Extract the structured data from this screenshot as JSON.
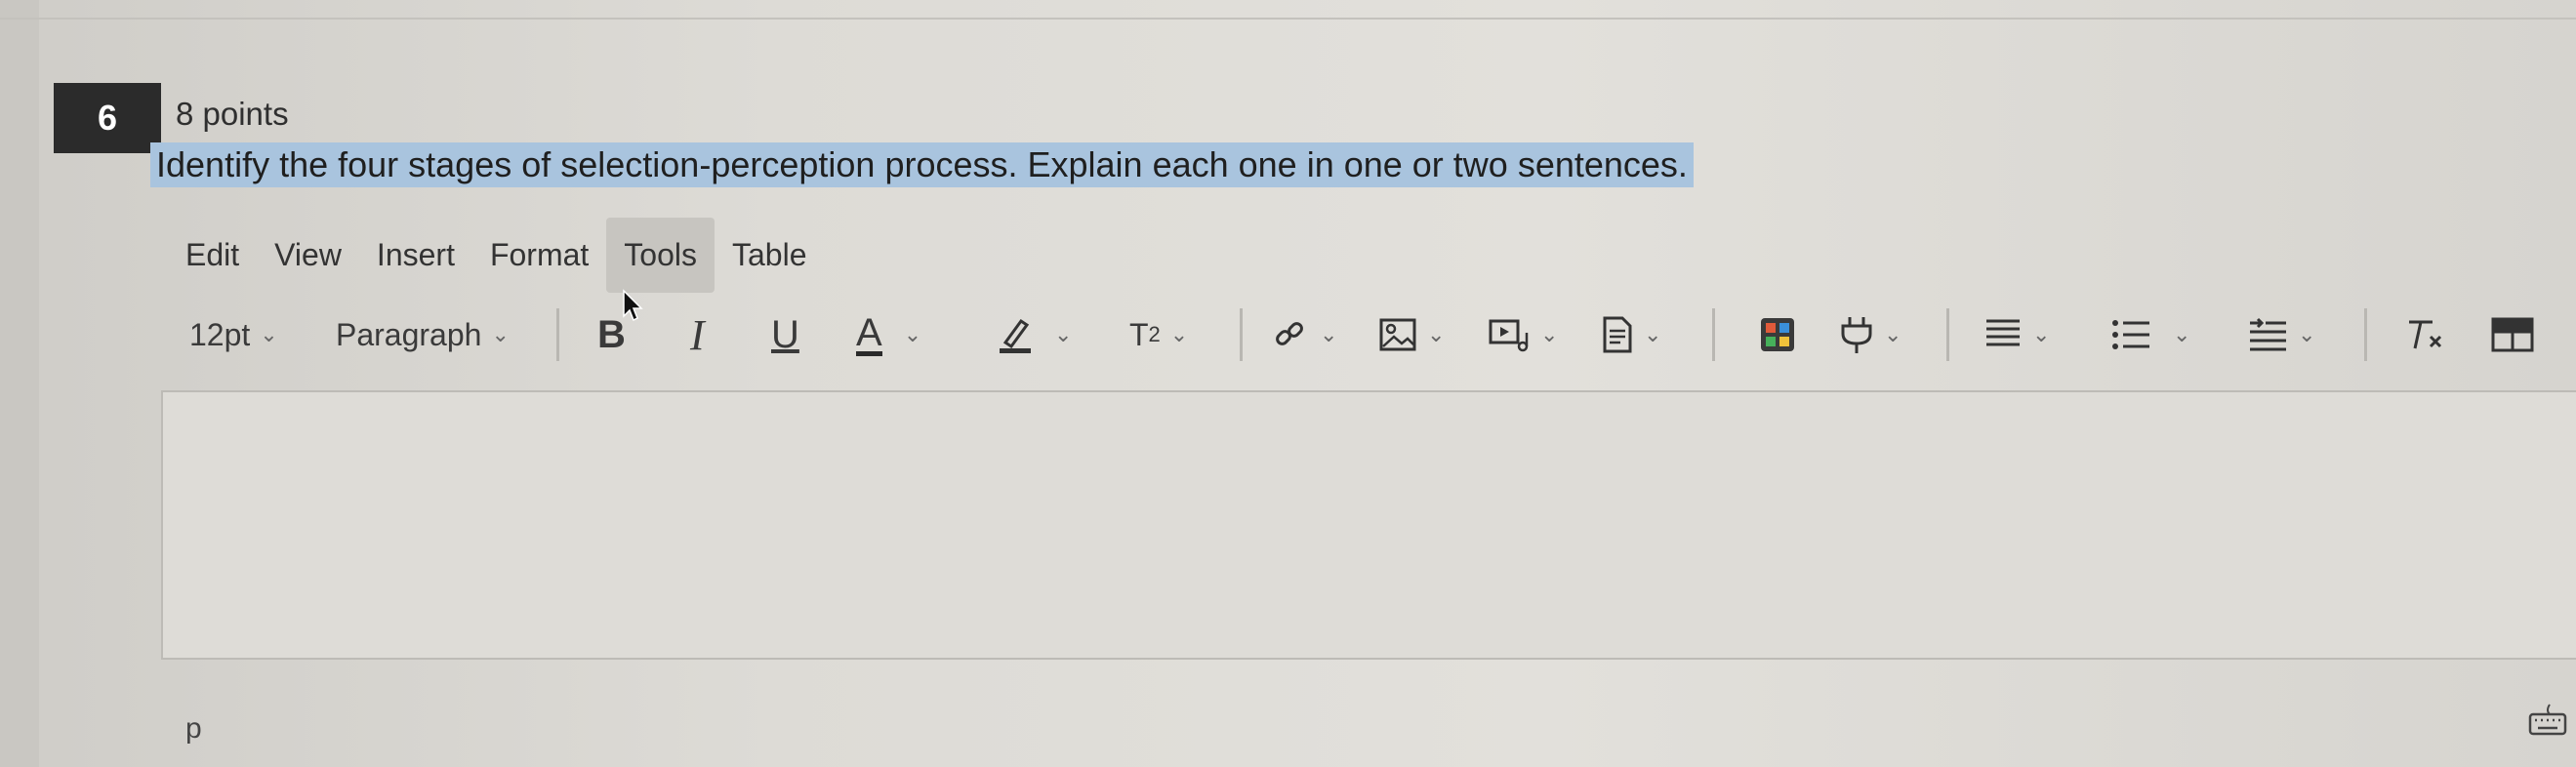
{
  "question": {
    "number": "6",
    "points": "8 points",
    "prompt": "Identify the four stages of selection-perception process. Explain each one in one or two sentences."
  },
  "menubar": {
    "items": [
      {
        "label": "Edit"
      },
      {
        "label": "View"
      },
      {
        "label": "Insert"
      },
      {
        "label": "Format"
      },
      {
        "label": "Tools",
        "active": true
      },
      {
        "label": "Table"
      }
    ]
  },
  "toolbar": {
    "font_size": "12pt",
    "block_format": "Paragraph",
    "bold": "B",
    "italic": "I",
    "underline": "U",
    "text_color": "A",
    "superscript": "T",
    "superscript_exp": "2",
    "icons": [
      "bold-icon",
      "italic-icon",
      "underline-icon",
      "text-color-icon",
      "highlight-icon",
      "superscript-icon",
      "link-icon",
      "image-icon",
      "media-icon",
      "document-icon",
      "apps-icon",
      "plugin-icon",
      "align-icon",
      "bullet-list-icon",
      "indent-icon",
      "clear-formatting-icon",
      "table-icon"
    ]
  },
  "editor": {
    "value": ""
  },
  "statusbar": {
    "path": "p",
    "keyboard_icon": "keyboard-icon"
  },
  "colors": {
    "highlight": "#a9c4de",
    "number_badge": "#2b2b2b",
    "active_menu": "#c7c5c0"
  }
}
